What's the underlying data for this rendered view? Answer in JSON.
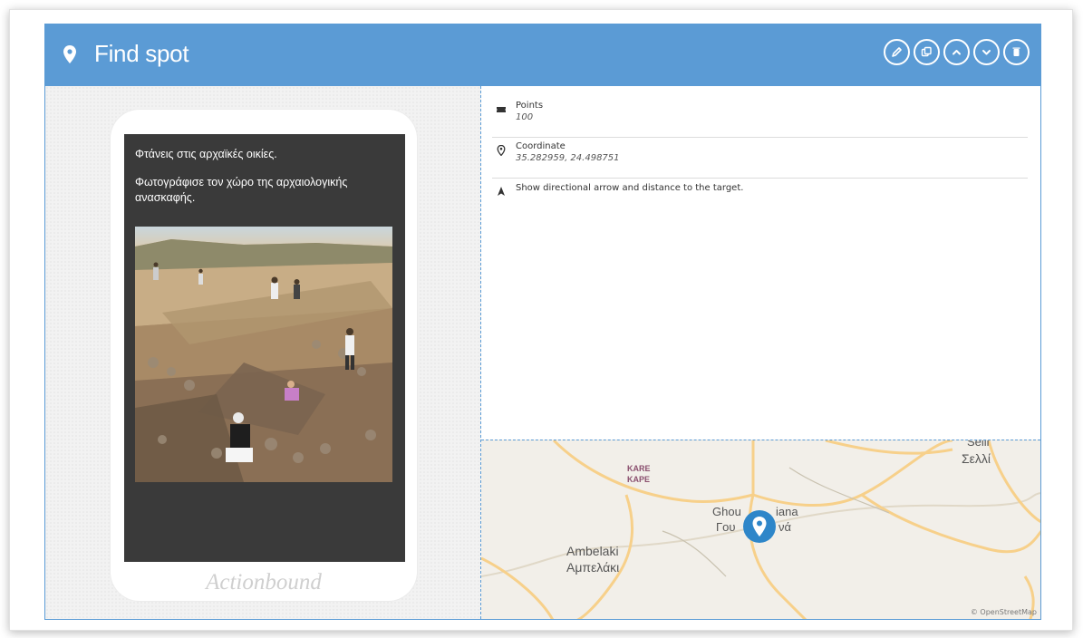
{
  "header": {
    "title": "Find spot",
    "icon": "location-pin-icon",
    "color": "#5b9bd5",
    "actions": [
      {
        "name": "edit-button",
        "icon": "pencil-icon"
      },
      {
        "name": "copy-button",
        "icon": "copy-icon"
      },
      {
        "name": "move-up-button",
        "icon": "chevron-up-icon"
      },
      {
        "name": "move-down-button",
        "icon": "chevron-down-icon"
      },
      {
        "name": "delete-button",
        "icon": "trash-icon"
      }
    ]
  },
  "preview": {
    "line1": "Φτάνεις στις αρχαϊκές οικίες.",
    "line2": "Φωτογράφισε τον χώρο της αρχαιολογικής ανασκαφής.",
    "photo": "excavation-site-photo",
    "brand": "Actionbound"
  },
  "details": {
    "points": {
      "label": "Points",
      "value": "100",
      "icon": "ticket-icon"
    },
    "coordinate": {
      "label": "Coordinate",
      "value": "35.282959, 24.498751",
      "icon": "location-pin-icon"
    },
    "arrow": {
      "label": "Show directional arrow and distance to the target.",
      "icon": "arrow-up-icon"
    }
  },
  "map": {
    "labels": {
      "kare1": "KARE",
      "kare2": "KAPE",
      "ghou": "Ghou",
      "iana": "iana",
      "gou": "Γου",
      "va": "νά",
      "ambelaki_en": "Ambelaki",
      "ambelaki_gr": "Αμπελάκι",
      "selli_en": "Selli",
      "selli_gr": "Σελλί"
    },
    "attribution": "© OpenStreetMap",
    "marker": "map-marker-icon"
  }
}
